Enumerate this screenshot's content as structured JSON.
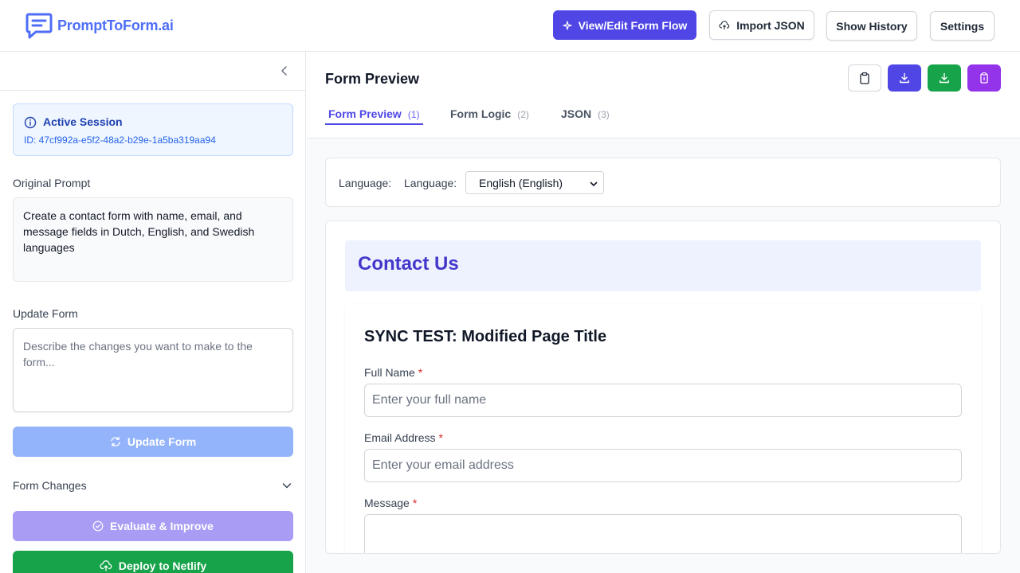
{
  "app": {
    "name": "PromptToForm.ai"
  },
  "header": {
    "view_edit_label": "View/Edit Form Flow",
    "import_label": "Import JSON",
    "history_label": "Show History",
    "settings_label": "Settings"
  },
  "sidebar": {
    "session_title": "Active Session",
    "session_id": "ID: 47cf992a-e5f2-48a2-b29e-1a5ba319aa94",
    "original_prompt_label": "Original Prompt",
    "original_prompt_text": "Create a contact form with name, email, and message fields in Dutch, English, and Swedish languages",
    "update_form_label": "Update Form",
    "update_placeholder": "Describe the changes you want to make to the form...",
    "update_button": "Update Form",
    "form_changes_label": "Form Changes",
    "evaluate_button": "Evaluate & Improve",
    "deploy_button": "Deploy to Netlify"
  },
  "main": {
    "title": "Form Preview",
    "tabs": [
      {
        "label": "Form Preview",
        "num": "(1)"
      },
      {
        "label": "Form Logic",
        "num": "(2)"
      },
      {
        "label": "JSON",
        "num": "(3)"
      }
    ],
    "language_label_1": "Language:",
    "language_label_2": "Language:",
    "language_selected": "English (English)"
  },
  "form": {
    "header_title": "Contact Us",
    "page_title": "SYNC TEST: Modified Page Title",
    "fields": [
      {
        "label": "Full Name",
        "required": "*",
        "placeholder": "Enter your full name"
      },
      {
        "label": "Email Address",
        "required": "*",
        "placeholder": "Enter your email address"
      },
      {
        "label": "Message",
        "required": "*",
        "placeholder": ""
      }
    ]
  },
  "colors": {
    "primary": "#4f46e5",
    "brand": "#4f6ef7",
    "download_blue": "#4f46e5",
    "download_green": "#16a34a",
    "purple": "#9333ea",
    "deploy_green": "#16a34a"
  },
  "icons": [
    "logo-chat-icon",
    "sparkle-icon",
    "cloud-upload-icon",
    "chevron-left-icon",
    "info-icon",
    "refresh-icon",
    "chevron-down-icon",
    "check-circle-icon",
    "clipboard-icon",
    "download-icon"
  ]
}
